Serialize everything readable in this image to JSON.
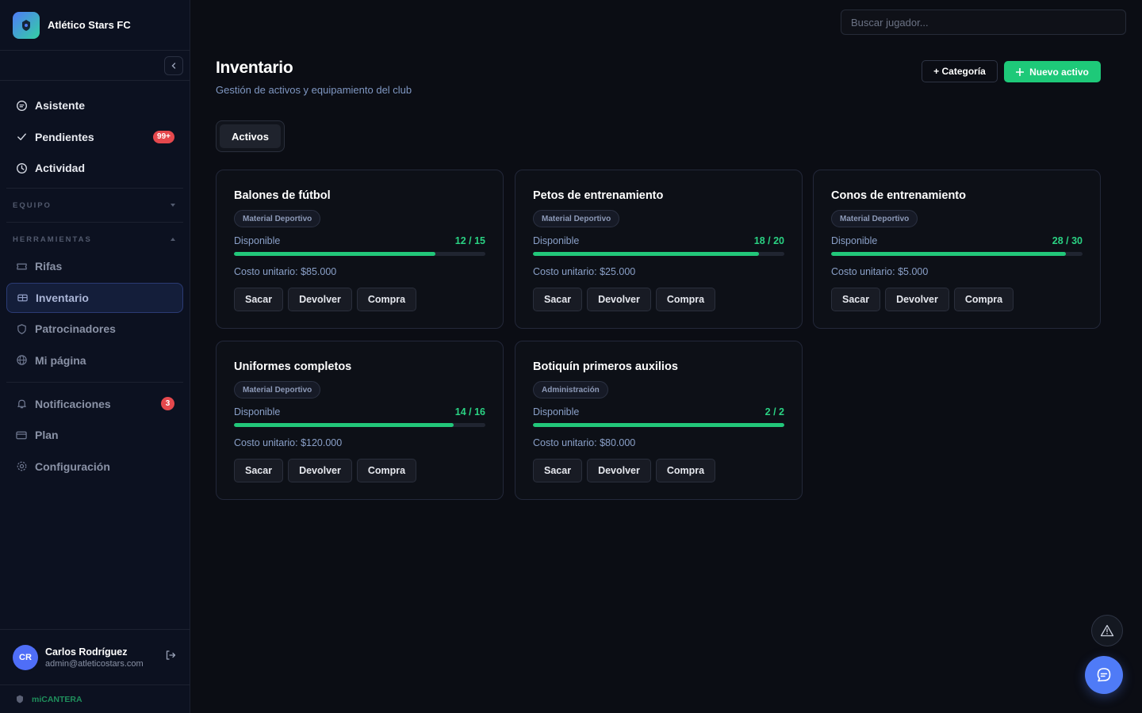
{
  "brand": {
    "name": "Atlético Stars FC"
  },
  "nav": {
    "main": [
      {
        "label": "Asistente",
        "icon": "chat-icon"
      },
      {
        "label": "Pendientes",
        "icon": "check-icon",
        "badge": "99+"
      },
      {
        "label": "Actividad",
        "icon": "clock-icon"
      }
    ],
    "section_equipo": "EQUIPO",
    "section_herramientas": "HERRAMIENTAS",
    "tools": [
      {
        "label": "Rifas",
        "icon": "ticket-icon"
      },
      {
        "label": "Inventario",
        "icon": "box-icon",
        "active": true
      },
      {
        "label": "Patrocinadores",
        "icon": "shield-icon"
      },
      {
        "label": "Mi página",
        "icon": "globe-icon"
      }
    ],
    "bottom": [
      {
        "label": "Notificaciones",
        "icon": "bell-icon",
        "badge": "3"
      },
      {
        "label": "Plan",
        "icon": "card-icon"
      },
      {
        "label": "Configuración",
        "icon": "gear-icon"
      }
    ]
  },
  "user": {
    "initials": "CR",
    "name": "Carlos Rodríguez",
    "email": "admin@atleticostars.com"
  },
  "footer": {
    "label": "miCANTERA"
  },
  "search": {
    "placeholder": "Buscar jugador..."
  },
  "page": {
    "title": "Inventario",
    "subtitle": "Gestión de activos y equipamiento del club",
    "category_button": "+ Categoría",
    "new_button": "Nuevo activo",
    "tab": "Activos"
  },
  "labels": {
    "available": "Disponible",
    "take": "Sacar",
    "return": "Devolver",
    "buy": "Compra"
  },
  "assets": [
    {
      "name": "Balones de fútbol",
      "category": "Material Deportivo",
      "available": 12,
      "total": 15,
      "count": "12 / 15",
      "cost": "Costo unitario: $85.000"
    },
    {
      "name": "Petos de entrenamiento",
      "category": "Material Deportivo",
      "available": 18,
      "total": 20,
      "count": "18 / 20",
      "cost": "Costo unitario: $25.000"
    },
    {
      "name": "Conos de entrenamiento",
      "category": "Material Deportivo",
      "available": 28,
      "total": 30,
      "count": "28 / 30",
      "cost": "Costo unitario: $5.000"
    },
    {
      "name": "Uniformes completos",
      "category": "Material Deportivo",
      "available": 14,
      "total": 16,
      "count": "14 / 16",
      "cost": "Costo unitario: $120.000"
    },
    {
      "name": "Botiquín primeros auxilios",
      "category": "Administración",
      "available": 2,
      "total": 2,
      "count": "2 / 2",
      "cost": "Costo unitario: $80.000"
    }
  ],
  "colors": {
    "accent_green": "#1ec979",
    "brand_blue": "#4f7bf7",
    "badge_red": "#e5484d",
    "background": "#0b0d14"
  }
}
